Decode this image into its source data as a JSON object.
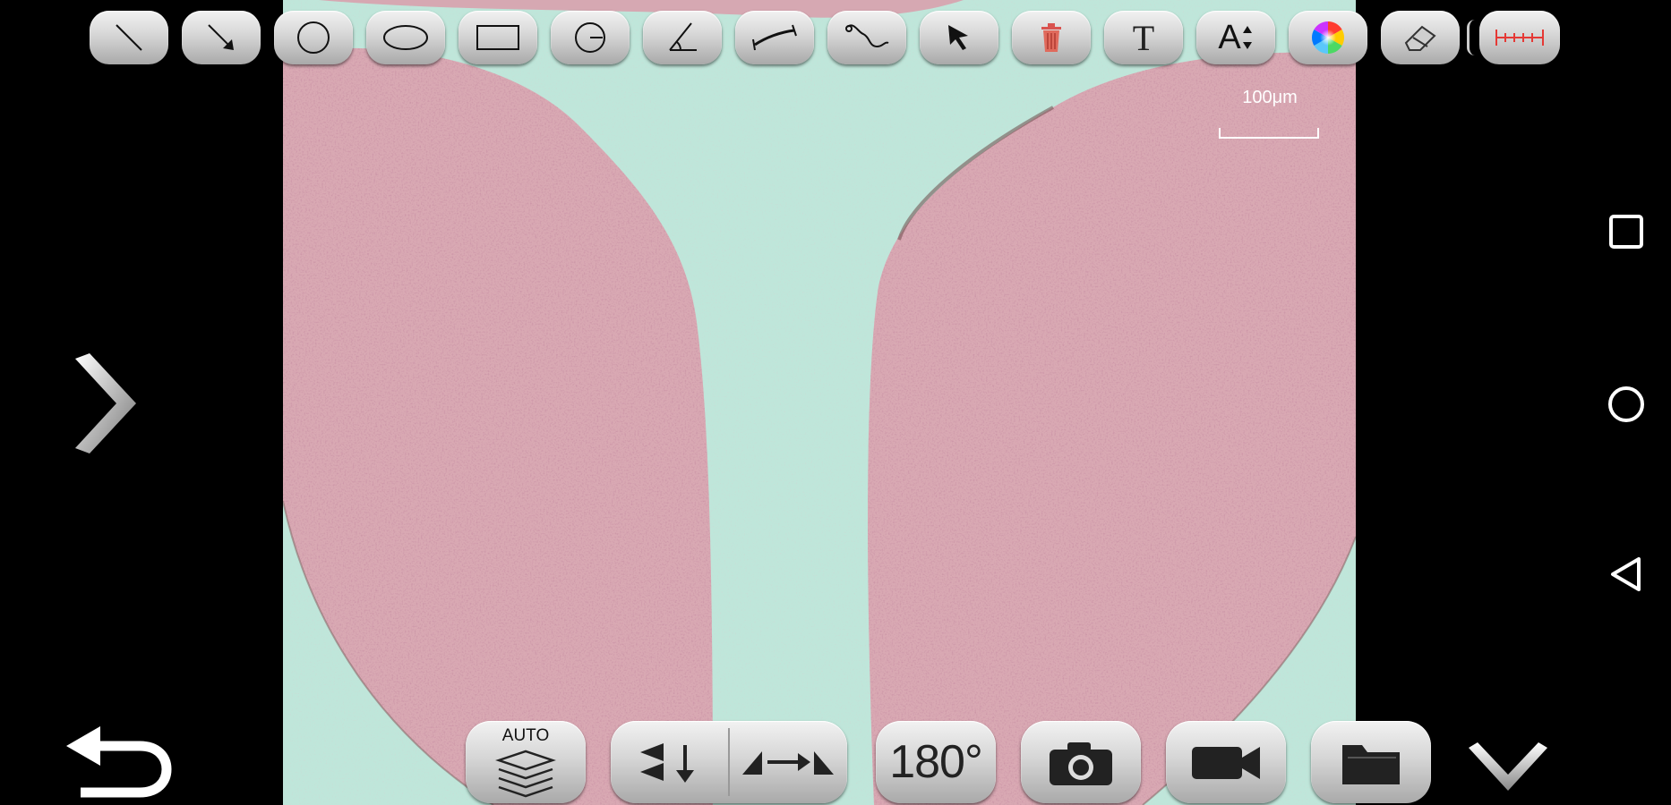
{
  "viewer": {
    "scale_label": "100μm",
    "colors": {
      "background": "#bfe6da",
      "tissue": "#d9a9b3"
    }
  },
  "toolbar": {
    "tools": [
      {
        "name": "line-tool",
        "icon": "line-icon"
      },
      {
        "name": "arrow-tool",
        "icon": "arrow-icon"
      },
      {
        "name": "circle-tool",
        "icon": "circle-icon"
      },
      {
        "name": "ellipse-tool",
        "icon": "ellipse-icon"
      },
      {
        "name": "rectangle-tool",
        "icon": "rectangle-icon"
      },
      {
        "name": "circle-center-tool",
        "icon": "circle-center-icon"
      },
      {
        "name": "angle-tool",
        "icon": "angle-icon"
      },
      {
        "name": "curve-measure-tool",
        "icon": "curve-measure-icon"
      },
      {
        "name": "freehand-tool",
        "icon": "freehand-icon"
      },
      {
        "name": "select-tool",
        "icon": "cursor-icon"
      },
      {
        "name": "delete-tool",
        "icon": "trash-icon"
      },
      {
        "name": "text-tool",
        "icon": "text-icon",
        "label": "T"
      },
      {
        "name": "font-size-tool",
        "icon": "font-size-icon",
        "label": "A"
      },
      {
        "name": "color-tool",
        "icon": "color-wheel-icon"
      },
      {
        "name": "eraser-tool",
        "icon": "eraser-icon"
      },
      {
        "name": "calibration-tool",
        "icon": "ruler-icon"
      }
    ]
  },
  "bottom_bar": {
    "auto_label": "AUTO",
    "rotate_label": "180°",
    "buttons": [
      "auto-stack-button",
      "flip-vertical-button",
      "flip-horizontal-button",
      "rotate-180-button",
      "capture-photo-button",
      "record-video-button",
      "open-folder-button"
    ]
  },
  "android_nav": [
    "recents-icon",
    "home-icon",
    "back-icon"
  ]
}
